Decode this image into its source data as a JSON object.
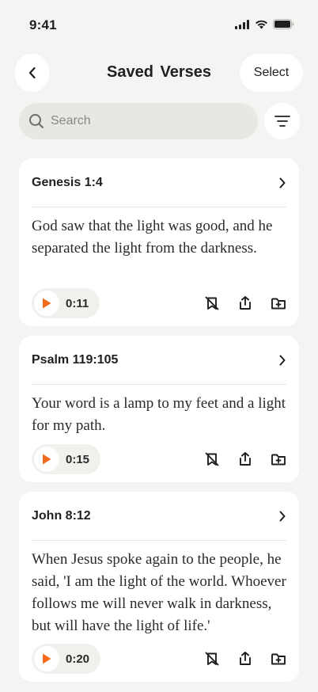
{
  "status": {
    "time": "9:41"
  },
  "header": {
    "title": "Saved Verses",
    "select_label": "Select"
  },
  "search": {
    "placeholder": "Search"
  },
  "colors": {
    "accent": "#f26a1b",
    "background": "#f5f4f2",
    "card": "#ffffff"
  },
  "verses": [
    {
      "reference": "Genesis 1:4",
      "text": "God saw that the light was good,  and he separated the light from the darkness.",
      "duration": "0:11"
    },
    {
      "reference": "Psalm 119:105",
      "text": "Your word is a lamp to my feet and a light for my path.",
      "duration": "0:15"
    },
    {
      "reference": "John 8:12",
      "text": "When Jesus spoke again to the people, he said, 'I am the light of the world. Whoever follows me will never walk in darkness, but will have the light of life.'",
      "duration": "0:20"
    }
  ],
  "icons": {
    "back": "chevron-left-icon",
    "filter": "filter-lines-icon",
    "search": "search-icon",
    "open": "chevron-right-icon",
    "play": "play-icon",
    "unsave": "bookmark-off-icon",
    "share": "share-icon",
    "add_to_folder": "folder-add-icon"
  }
}
